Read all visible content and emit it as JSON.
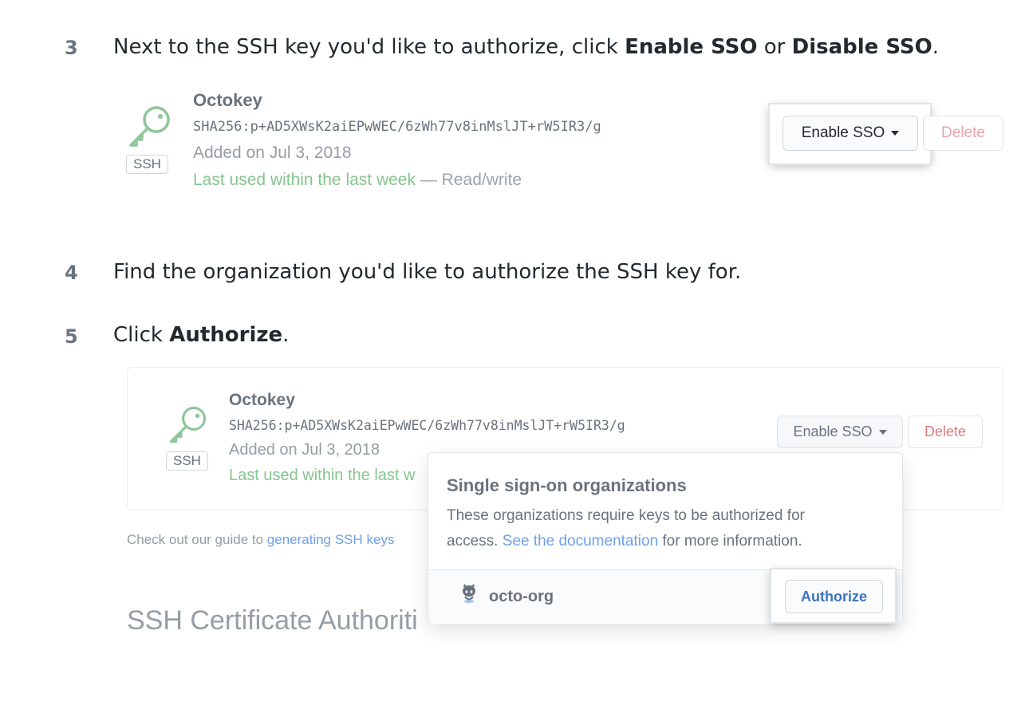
{
  "steps": [
    {
      "number": "3",
      "pre": "Next to the SSH key you'd like to authorize, click ",
      "bold1": "Enable SSO",
      "mid": " or ",
      "bold2": "Disable SSO",
      "post": "."
    },
    {
      "number": "4",
      "text": "Find the organization you'd like to authorize the SSH key for."
    },
    {
      "number": "5",
      "pre": "Click ",
      "bold": "Authorize",
      "post": "."
    }
  ],
  "key_top": {
    "title": "Octokey",
    "fingerprint": "SHA256:p+AD5XWsK2aiEPwWEC/6zWh77v8inMslJT+rW5IR3/g",
    "added": "Added on Jul 3, 2018",
    "last_used": "Last used within the last week",
    "access": " — Read/write",
    "type_label": "SSH",
    "enable_sso": "Enable SSO",
    "delete": "Delete"
  },
  "key_bottom": {
    "title": "Octokey",
    "fingerprint": "SHA256:p+AD5XWsK2aiEPwWEC/6zWh77v8inMslJT+rW5IR3/g",
    "added": "Added on Jul 3, 2018",
    "last_used": "Last used within the last w",
    "type_label": "SSH",
    "enable_sso": "Enable SSO",
    "delete": "Delete"
  },
  "guide": {
    "pre": "Check out our guide to ",
    "link": "generating SSH keys"
  },
  "ssh_ca_heading": "SSH Certificate Authoriti",
  "dropdown": {
    "title": "Single sign-on organizations",
    "desc_line1": "These organizations require keys to be authorized for",
    "desc_pre": "access. ",
    "desc_link": "See the documentation",
    "desc_post": " for more information.",
    "org_name": "octo-org",
    "authorize": "Authorize"
  },
  "colors": {
    "link": "#6ea0e8",
    "danger": "#de7a80",
    "success": "#85c58f",
    "authorize_text": "#3b73c5"
  },
  "icons": [
    "key-icon",
    "caret-down-icon",
    "octocat-icon"
  ]
}
